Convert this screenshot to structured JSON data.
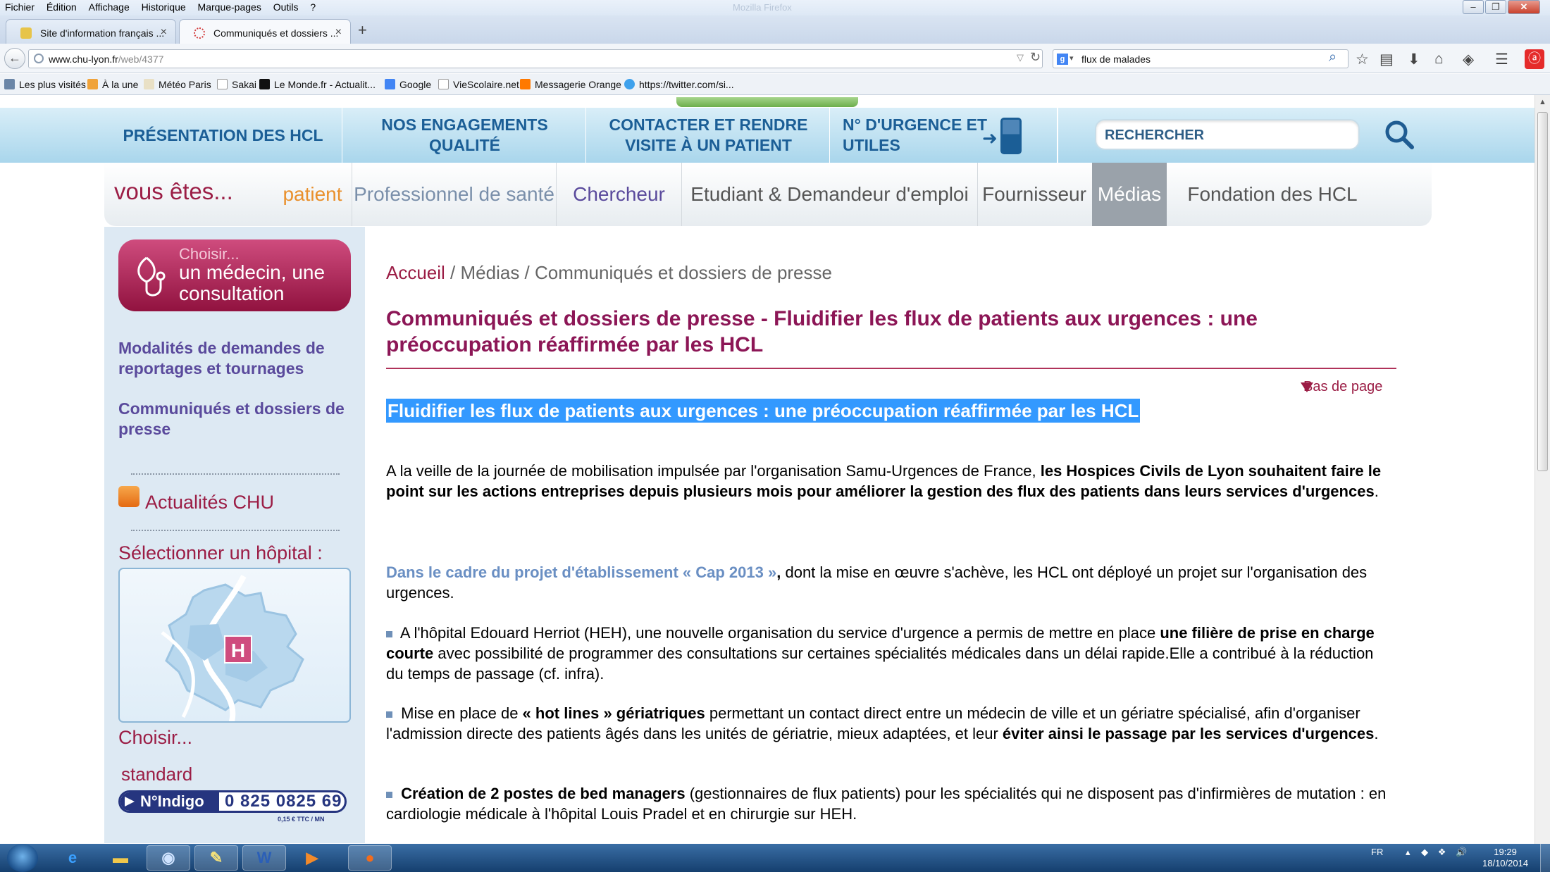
{
  "browser": {
    "menu": [
      "Fichier",
      "Édition",
      "Affichage",
      "Historique",
      "Marque-pages",
      "Outils",
      "?"
    ],
    "ghost_title": "Mozilla Firefox",
    "tabs": [
      {
        "title": "Site d'information français ...",
        "active": false
      },
      {
        "title": "Communiqués et dossiers ...",
        "active": true
      }
    ],
    "new_tab": "+",
    "url_domain": "www.chu-lyon.fr",
    "url_path": "/web/4377",
    "search_query": "flux de malades",
    "bookmarks": [
      {
        "label": "Les plus visités",
        "icon": "folder-icon"
      },
      {
        "label": "À la une",
        "icon": "rss-icon"
      },
      {
        "label": "Météo Paris",
        "icon": "weather-icon"
      },
      {
        "label": "Sakai",
        "icon": "page-icon"
      },
      {
        "label": "Le Monde.fr - Actualit...",
        "icon": "lemonde-icon"
      },
      {
        "label": "Google",
        "icon": "google-icon"
      },
      {
        "label": "VieScolaire.net",
        "icon": "page-icon"
      },
      {
        "label": "Messagerie Orange",
        "icon": "orange-icon"
      },
      {
        "label": "https://twitter.com/si...",
        "icon": "twitter-icon"
      }
    ]
  },
  "site": {
    "nav": [
      {
        "label": "PRÉSENTATION DES HCL"
      },
      {
        "label": "NOS ENGAGEMENTS QUALITÉ"
      },
      {
        "label": "CONTACTER ET RENDRE VISITE À UN PATIENT"
      },
      {
        "label": "N° D'URGENCE ET UTILES"
      }
    ],
    "search_placeholder": "RECHERCHER",
    "audience_intro": "vous êtes...",
    "audience": [
      {
        "label": "patient",
        "color": "#e9902c"
      },
      {
        "label": "Professionnel de santé",
        "color": "#7a8faa"
      },
      {
        "label": "Chercheur",
        "color": "#5a4a9c"
      },
      {
        "label": "Etudiant & Demandeur d'emploi",
        "color": "#555555"
      },
      {
        "label": "Fournisseur",
        "color": "#555555"
      },
      {
        "label": "Médias",
        "color": "#ffffff"
      },
      {
        "label": "Fondation des HCL",
        "color": "#555555"
      }
    ]
  },
  "sidebar": {
    "choisir_small": "Choisir...",
    "choisir_big": "un médecin, une consultation",
    "links": [
      "Modalités de demandes de reportages et tournages",
      "Communiqués et dossiers de presse"
    ],
    "actualites": "Actualités CHU",
    "select_hospital": "Sélectionner un hôpital :",
    "map_marker": "H",
    "choisir": "Choisir...",
    "standard": "standard",
    "indigo_label": "N°Indigo",
    "indigo_number": "0 825 0825 69",
    "indigo_price": "0,15 € TTC / MN"
  },
  "main": {
    "breadcrumb": {
      "home": "Accueil",
      "sep": " / ",
      "section": "Médias",
      "current": "Communiqués et dossiers de presse"
    },
    "title": "Communiqués et dossiers de presse - Fluidifier les flux de patients aux urgences : une préoccupation réaffirmée par les HCL",
    "bas_de_page": "Bas de page",
    "highlight": "Fluidifier les flux de patients aux urgences : une préoccupation réaffirmée par les HCL",
    "p1_a": "A la veille de la journée de mobilisation impulsée par l'organisation Samu-Urgences de France, ",
    "p1_b": "les Hospices Civils de Lyon souhaitent faire le point sur les actions entreprises depuis plusieurs mois pour améliorer la gestion des flux des patients dans leurs services d'urgences",
    "p1_c": ".",
    "p2_a": "Dans le cadre du projet d'établissement « Cap 2013 »",
    "p2_b": ",",
    "p2_c": " dont la mise en œuvre s'achève, les HCL ont déployé un projet sur l'organisation des urgences.",
    "p3_a": " A l'hôpital Edouard Herriot (HEH), une nouvelle organisation du service d'urgence a permis de mettre en place ",
    "p3_b": "une filière de prise en charge courte",
    "p3_c": " avec possibilité de programmer des consultations sur certaines spécialités médicales dans un délai rapide.Elle a contribué à la réduction du temps de passage (cf. infra).",
    "p4_a": " Mise en place de ",
    "p4_b": "« hot lines » gériatriques",
    "p4_c": " permettant un contact direct entre un médecin de ville et un gériatre spécialisé, afin d'organiser l'admission directe des patients âgés dans les unités de gériatrie, mieux adaptées, et leur ",
    "p4_d": "éviter ainsi le passage par les services d'urgences",
    "p4_e": ".",
    "p5_a": " Création de 2 postes de bed managers",
    "p5_b": " (gestionnaires de flux patients) pour les spécialités qui ne disposent pas d'infirmières de mutation : en cardiologie médicale à l'hôpital Louis Pradel et en chirurgie sur HEH."
  },
  "taskbar": {
    "apps": [
      {
        "name": "ie-app",
        "glyph": "e",
        "color": "#3aa0ff",
        "open": false
      },
      {
        "name": "explorer-app",
        "glyph": "▬",
        "color": "#f1c84b",
        "open": false
      },
      {
        "name": "thunderbird-app",
        "glyph": "◉",
        "color": "#cfe3ff",
        "open": true
      },
      {
        "name": "paint-app",
        "glyph": "✎",
        "color": "#f6e27a",
        "open": true
      },
      {
        "name": "word-app",
        "glyph": "W",
        "color": "#2b5fb7",
        "open": true
      },
      {
        "name": "media-player-app",
        "glyph": "▶",
        "color": "#f38a2a",
        "open": false
      },
      {
        "name": "firefox-app",
        "glyph": "●",
        "color": "#f26c1c",
        "open": true
      }
    ],
    "lang": "FR",
    "time": "19:29",
    "date": "18/10/2014"
  }
}
